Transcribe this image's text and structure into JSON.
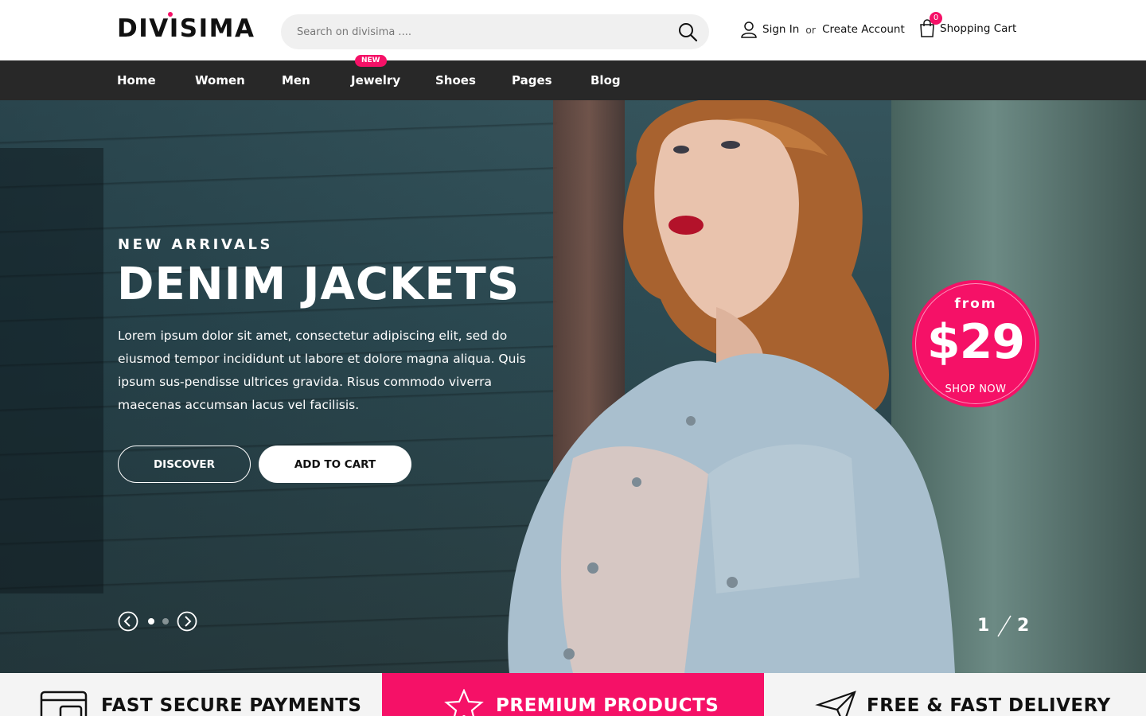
{
  "brand": {
    "logo_text": "DIVISIMA",
    "accent_color": "#f51167"
  },
  "search": {
    "placeholder": "Search on divisima ...."
  },
  "account": {
    "sign_in": "Sign In",
    "or": "or",
    "create": "Create Account"
  },
  "cart": {
    "count": "0",
    "label": "Shopping Cart"
  },
  "nav": {
    "items": [
      {
        "label": "Home"
      },
      {
        "label": "Women"
      },
      {
        "label": "Men"
      },
      {
        "label": "Jewelry"
      },
      {
        "label": "Shoes"
      },
      {
        "label": "Pages"
      },
      {
        "label": "Blog"
      }
    ],
    "badge": "NEW"
  },
  "hero": {
    "subtitle": "NEW ARRIVALS",
    "title": "DENIM JACKETS",
    "text": "Lorem ipsum dolor sit amet, consectetur adipiscing elit, sed do eiusmod tempor incididunt ut labore et dolore magna aliqua. Quis ipsum sus-pendisse ultrices gravida. Risus commodo viverra maecenas accumsan lacus vel facilisis.",
    "discover_label": "DISCOVER",
    "cart_label": "ADD TO CART",
    "offer": {
      "from": "from",
      "price": "$29",
      "shop": "SHOP NOW"
    },
    "slide_current": "1",
    "slide_total": "2"
  },
  "features": [
    {
      "label": "FAST SECURE PAYMENTS",
      "icon": "credit-card-icon"
    },
    {
      "label": "PREMIUM PRODUCTS",
      "icon": "star-icon"
    },
    {
      "label": "FREE & FAST DELIVERY",
      "icon": "paper-plane-icon"
    }
  ]
}
